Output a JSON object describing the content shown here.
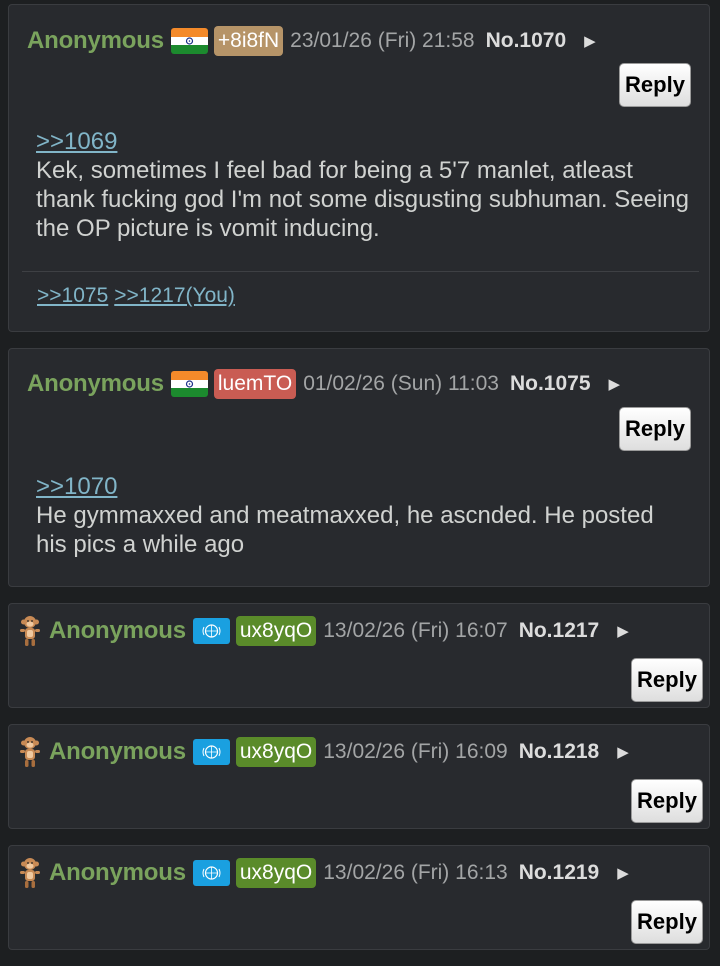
{
  "posts": [
    {
      "name": "Anonymous",
      "flag": "india-flag",
      "uid": "+8i8fN",
      "uid_color": "#b69468",
      "date": "23/01/26 (Fri) 21:58",
      "no": "No.1070",
      "reply": "Reply",
      "quote": ">>1069",
      "text": "Kek, sometimes I feel bad for being a 5'7 manlet, atleast thank fucking god I'm not some disgusting subhuman. Seeing the OP picture is vomit inducing.",
      "backlinks": [
        ">>1075",
        ">>1217(You)"
      ]
    },
    {
      "name": "Anonymous",
      "flag": "india-flag",
      "uid": "luemTO",
      "uid_color": "#c95c53",
      "date": "01/02/26 (Sun) 11:03",
      "no": "No.1075",
      "reply": "Reply",
      "quote": ">>1070",
      "text": "He gymmaxxed and meatmaxxed, he ascnded. He posted his pics a while ago"
    },
    {
      "name": "Anonymous",
      "flag": "un-flag",
      "uid": "ux8yqO",
      "uid_color": "#5a8b2a",
      "date": "13/02/26 (Fri) 16:07",
      "no": "No.1217",
      "reply": "Reply"
    },
    {
      "name": "Anonymous",
      "flag": "un-flag",
      "uid": "ux8yqO",
      "uid_color": "#5a8b2a",
      "date": "13/02/26 (Fri) 16:09",
      "no": "No.1218",
      "reply": "Reply"
    },
    {
      "name": "Anonymous",
      "flag": "un-flag",
      "uid": "ux8yqO",
      "uid_color": "#5a8b2a",
      "date": "13/02/26 (Fri) 16:13",
      "no": "No.1219",
      "reply": "Reply"
    }
  ],
  "arrow_glyph": "▶"
}
